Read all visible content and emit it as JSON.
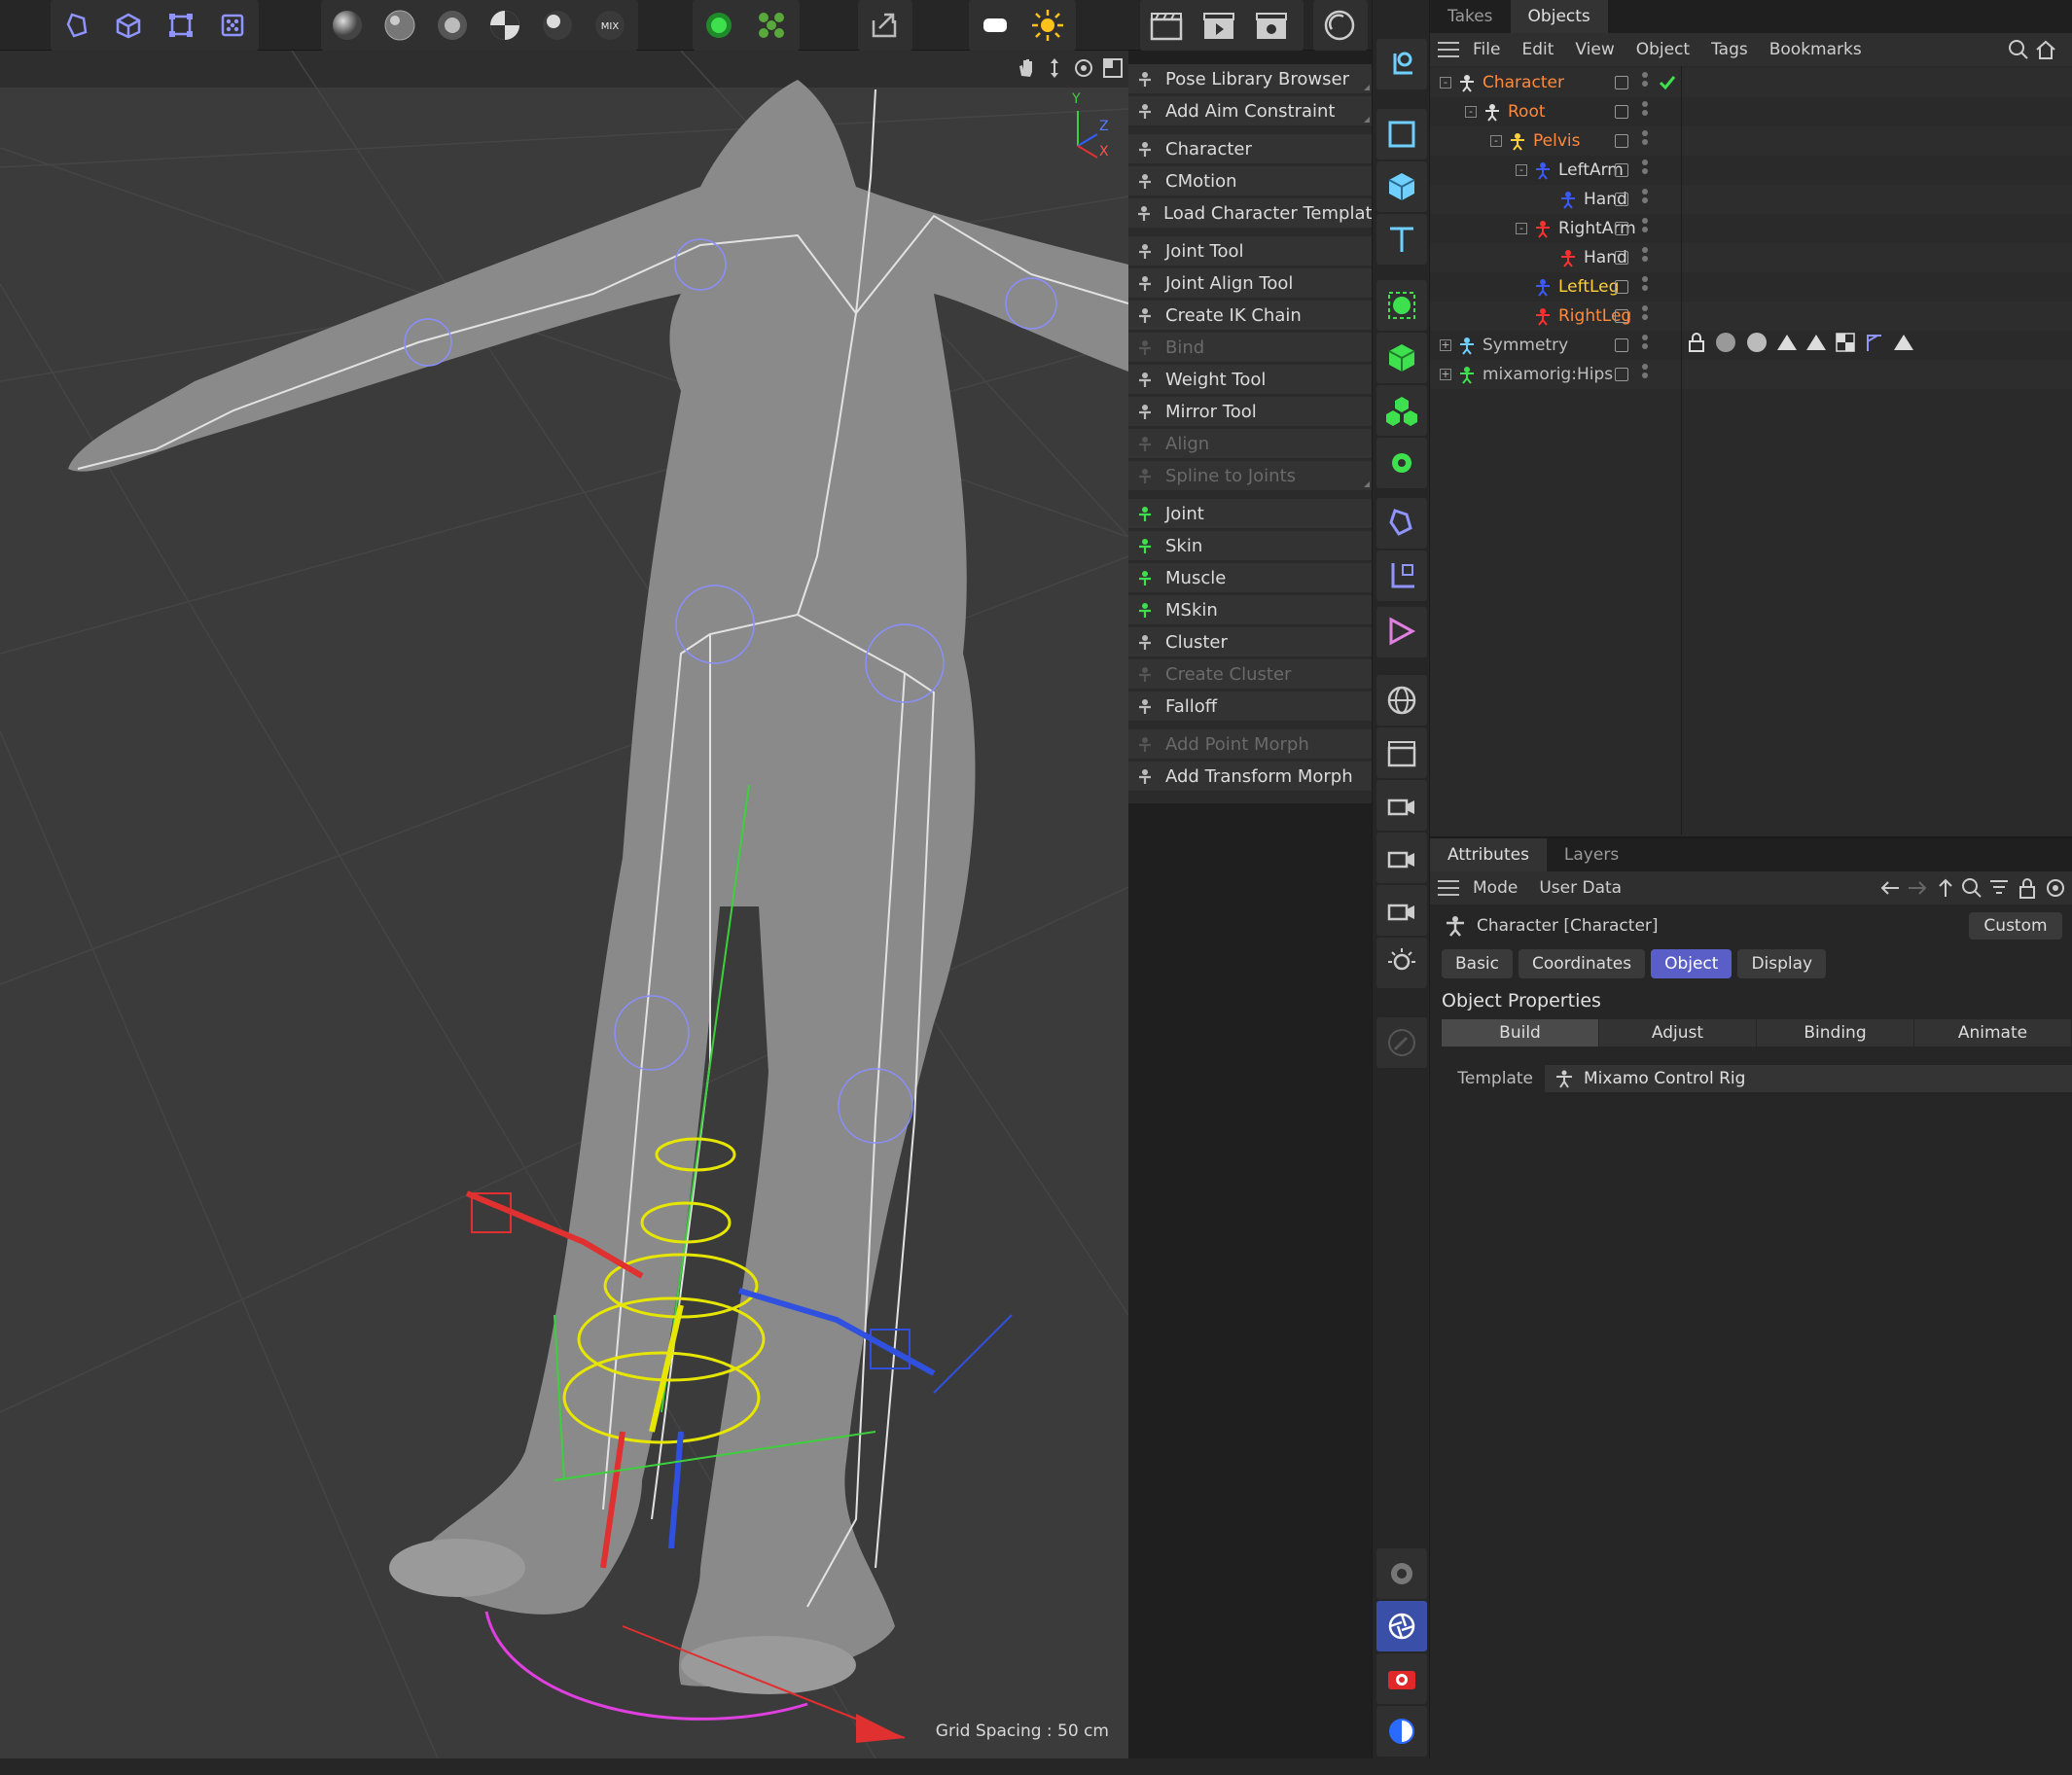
{
  "objects_panel": {
    "tabs": [
      "Takes",
      "Objects"
    ],
    "active_tab": "Objects",
    "menu": [
      "File",
      "Edit",
      "View",
      "Object",
      "Tags",
      "Bookmarks"
    ],
    "tree": [
      {
        "name": "Character",
        "color": "#ff8a3d",
        "indent": 0,
        "icon": "character-icon",
        "expand": "-"
      },
      {
        "name": "Root",
        "color": "#ff8a3d",
        "indent": 1,
        "icon": "root-null-icon",
        "expand": "-"
      },
      {
        "name": "Pelvis",
        "color": "#ff8a3d",
        "indent": 2,
        "icon": "pelvis-icon",
        "expand": "-"
      },
      {
        "name": "LeftArm",
        "color": "#d9d9d9",
        "indent": 3,
        "icon": "left-arm-icon",
        "expand": "-"
      },
      {
        "name": "Hand",
        "color": "#d9d9d9",
        "indent": 4,
        "icon": "left-hand-icon",
        "expand": ""
      },
      {
        "name": "RightArm",
        "color": "#d9d9d9",
        "indent": 3,
        "icon": "right-arm-icon",
        "expand": "-"
      },
      {
        "name": "Hand",
        "color": "#d9d9d9",
        "indent": 4,
        "icon": "right-hand-icon",
        "expand": ""
      },
      {
        "name": "LeftLeg",
        "color": "#ffd23d",
        "indent": 3,
        "icon": "left-leg-icon",
        "expand": ""
      },
      {
        "name": "RightLeg",
        "color": "#ff8a3d",
        "indent": 3,
        "icon": "right-leg-icon",
        "expand": ""
      },
      {
        "name": "Symmetry",
        "color": "#bfbfbf",
        "indent": 0,
        "icon": "symmetry-icon",
        "expand": "+"
      },
      {
        "name": "mixamorig:Hips",
        "color": "#bfbfbf",
        "indent": 0,
        "icon": "joint-icon",
        "expand": "+"
      }
    ]
  },
  "character_menu": [
    {
      "label": "Pose Library Browser",
      "icon": "pose-library-icon",
      "disabled": false,
      "sub": true
    },
    {
      "label": "Add Aim Constraint",
      "icon": "aim-constraint-icon",
      "disabled": false,
      "sub": true
    },
    {
      "label": "Character",
      "icon": "character-icon",
      "disabled": false,
      "sub": false
    },
    {
      "label": "CMotion",
      "icon": "cmotion-icon",
      "disabled": false,
      "sub": false
    },
    {
      "label": "Load Character Template...",
      "icon": "folder-icon",
      "disabled": false,
      "sub": false
    },
    {
      "label": "Joint Tool",
      "icon": "joint-tool-icon",
      "disabled": false,
      "sub": false
    },
    {
      "label": "Joint Align Tool",
      "icon": "joint-align-icon",
      "disabled": false,
      "sub": false
    },
    {
      "label": "Create IK Chain",
      "icon": "ik-chain-icon",
      "disabled": false,
      "sub": false
    },
    {
      "label": "Bind",
      "icon": "bind-icon",
      "disabled": true,
      "sub": false
    },
    {
      "label": "Weight Tool",
      "icon": "weight-tool-icon",
      "disabled": false,
      "sub": false
    },
    {
      "label": "Mirror Tool",
      "icon": "mirror-tool-icon",
      "disabled": false,
      "sub": false
    },
    {
      "label": "Align",
      "icon": "align-icon",
      "disabled": true,
      "sub": false
    },
    {
      "label": "Spline to Joints",
      "icon": "spline-joints-icon",
      "disabled": true,
      "sub": true
    },
    {
      "label": "Joint",
      "icon": "joint-icon",
      "disabled": false,
      "sub": false
    },
    {
      "label": "Skin",
      "icon": "skin-icon",
      "disabled": false,
      "sub": false
    },
    {
      "label": "Muscle",
      "icon": "muscle-icon",
      "disabled": false,
      "sub": false
    },
    {
      "label": "MSkin",
      "icon": "mskin-icon",
      "disabled": false,
      "sub": false
    },
    {
      "label": "Cluster",
      "icon": "cluster-icon",
      "disabled": false,
      "sub": false
    },
    {
      "label": "Create Cluster",
      "icon": "create-cluster-icon",
      "disabled": true,
      "sub": false
    },
    {
      "label": "Falloff",
      "icon": "falloff-icon",
      "disabled": false,
      "sub": false
    },
    {
      "label": "Add Point Morph",
      "icon": "point-morph-icon",
      "disabled": true,
      "sub": false
    },
    {
      "label": "Add Transform Morph",
      "icon": "transform-morph-icon",
      "disabled": false,
      "sub": false
    }
  ],
  "attributes": {
    "tabs": [
      "Attributes",
      "Layers"
    ],
    "active_tab": "Attributes",
    "menu": [
      "Mode",
      "User Data"
    ],
    "object_title": "Character [Character]",
    "custom_label": "Custom",
    "pills": [
      "Basic",
      "Coordinates",
      "Object",
      "Display"
    ],
    "active_pill": "Object",
    "section": "Object Properties",
    "subtabs": [
      "Build",
      "Adjust",
      "Binding",
      "Animate"
    ],
    "active_subtab": "Build",
    "template_label": "Template",
    "template_value": "Mixamo Control Rig"
  },
  "viewport": {
    "grid_spacing": "Grid Spacing : 50 cm"
  },
  "axis": {
    "x": "X",
    "y": "Y",
    "z": "Z"
  },
  "colors": {
    "accent": "#5a5fc8",
    "highlight_orange": "#ff8a3d",
    "highlight_yellow": "#ffd23d"
  }
}
